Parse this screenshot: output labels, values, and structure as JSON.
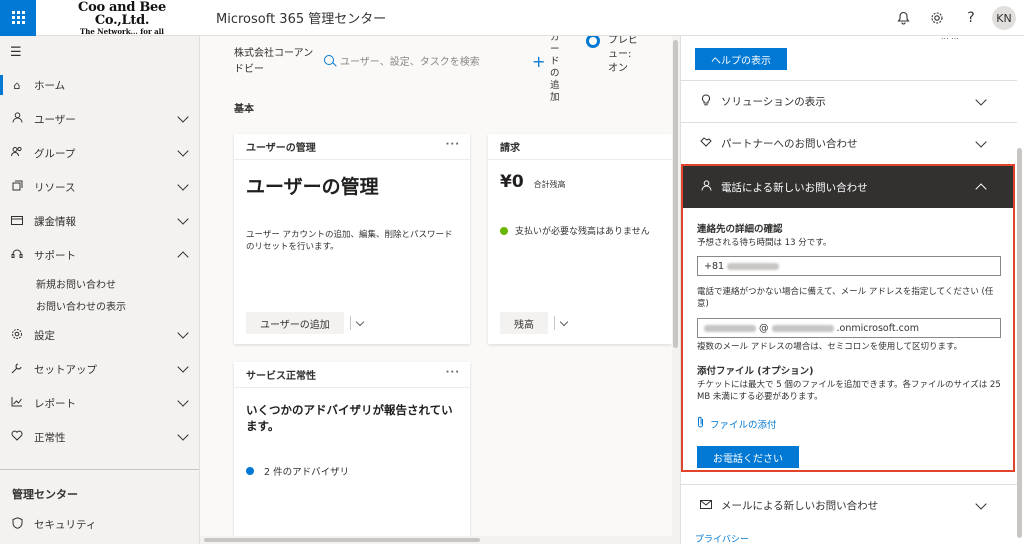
{
  "header": {
    "logo_main": "Coo and Bee Co.,Ltd.",
    "logo_sub": "The Network... for all",
    "app_title": "Microsoft 365 管理センター",
    "avatar_initials": "KN",
    "icons": [
      "bell-icon",
      "gear-icon",
      "help-icon"
    ]
  },
  "sidebar": {
    "items": [
      {
        "label": "ホーム",
        "icon": "home-icon"
      },
      {
        "label": "ユーザー",
        "icon": "user-icon"
      },
      {
        "label": "グループ",
        "icon": "group-icon"
      },
      {
        "label": "リソース",
        "icon": "resource-icon"
      },
      {
        "label": "課金情報",
        "icon": "billing-icon"
      },
      {
        "label": "サポート",
        "icon": "headset-icon"
      },
      {
        "label": "設定",
        "icon": "gear-icon"
      },
      {
        "label": "セットアップ",
        "icon": "wrench-icon"
      },
      {
        "label": "レポート",
        "icon": "chart-icon"
      },
      {
        "label": "正常性",
        "icon": "heart-icon"
      }
    ],
    "support_sub": [
      "新規お問い合わせ",
      "お問い合わせの表示"
    ],
    "admin_heading": "管理センター",
    "security_label": "セキュリティ"
  },
  "main": {
    "org_name": "株式会社コーアンドビー",
    "search_placeholder": "ユーザー、設定、タスクを検索",
    "add_card": "カードの追加",
    "preview": "プレビュー: オン",
    "section_title": "基本",
    "user_card": {
      "header": "ユーザーの管理",
      "title": "ユーザーの管理",
      "desc": "ユーザー アカウントの追加、編集、削除とパスワードのリセットを行います。",
      "button": "ユーザーの追加"
    },
    "billing_card": {
      "header": "請求",
      "amount": "¥0",
      "amount_label": "合計残高",
      "status": "支払いが必要な残高はありません",
      "button": "残高"
    },
    "health_card": {
      "header": "サービス正常性",
      "title": "いくつかのアドバイザリが報告されています。",
      "advisory": "2 件のアドバイザリ"
    }
  },
  "panel": {
    "help_button": "ヘルプの表示",
    "top_cut_text": "... ...",
    "solutions": "ソリューションの表示",
    "partner": "パートナーへのお問い合わせ",
    "phone_header": "電話による新しいお問い合わせ",
    "contact_title": "連絡先の詳細の確認",
    "wait_time": "予想される待ち時間は 13 分です。",
    "phone_value": "+81",
    "email_note": "電話で連絡がつかない場合に備えて、メール アドレスを指定してください (任意)",
    "email_at": "@",
    "email_domain": ".onmicrosoft.com",
    "email_multi": "複数のメール アドレスの場合は、セミコロンを使用して区切ります。",
    "attach_title": "添付ファイル (オプション)",
    "attach_desc": "チケットには最大で 5 個のファイルを追加できます。各ファイルのサイズは 25 MB 未満にする必要があります。",
    "attach_link": "ファイルの添付",
    "call_button": "お電話ください",
    "email_contact": "メールによる新しいお問い合わせ",
    "privacy": "プライバシー"
  },
  "colors": {
    "accent": "#0078d4",
    "highlight": "#e0452b",
    "dark_header": "#323130",
    "ok": "#6bb700"
  }
}
